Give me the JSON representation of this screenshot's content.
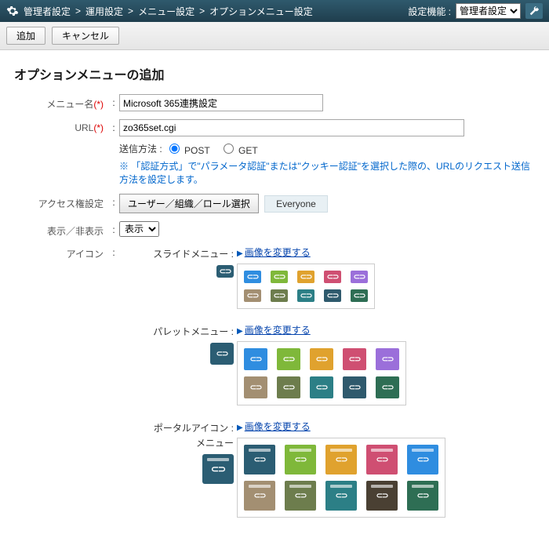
{
  "header": {
    "breadcrumbs": [
      "管理者設定",
      "運用設定",
      "メニュー設定",
      "オプションメニュー設定"
    ],
    "sep": ">",
    "setting_label": "設定機能 :",
    "setting_select": "管理者設定"
  },
  "toolbar": {
    "add": "追加",
    "cancel": "キャンセル"
  },
  "title": "オプションメニューの追加",
  "form": {
    "menu_name_label": "メニュー名",
    "menu_name_value": "Microsoft 365連携設定",
    "url_label": "URL",
    "url_value": "zo365set.cgi",
    "send_label": "送信方法 :",
    "post": "POST",
    "get": "GET",
    "note": "※ 「認証方式」で\"パラメータ認証\"または\"クッキー認証\"を選択した際の、URLのリクエスト送信方法を設定します。",
    "access_label": "アクセス権設定",
    "access_button": "ユーザー／組織／ロール選択",
    "access_value": "Everyone",
    "display_label": "表示／非表示",
    "display_value": "表示",
    "icon_label": "アイコン"
  },
  "icon": {
    "slide_label": "スライドメニュー",
    "palette_label": "パレットメニュー",
    "portal_label": "ポータルアイコン",
    "portal_sub": "メニュー",
    "change_link": "画像を変更する",
    "colors_row1": [
      "#2f8de0",
      "#7fb83a",
      "#e0a22e",
      "#cf4f72",
      "#9b6fda"
    ],
    "colors_row2": [
      "#a38f72",
      "#6d7d4d",
      "#2c7f86",
      "#2f5a6d",
      "#2e6e54"
    ],
    "portal_row1": [
      "#2b5d73",
      "#7fb83a",
      "#e0a22e",
      "#cf4f72",
      "#2f8de0"
    ],
    "portal_row2": [
      "#a38f72",
      "#6d7d4d",
      "#2c7f86",
      "#4a4033",
      "#2e6e54"
    ]
  }
}
